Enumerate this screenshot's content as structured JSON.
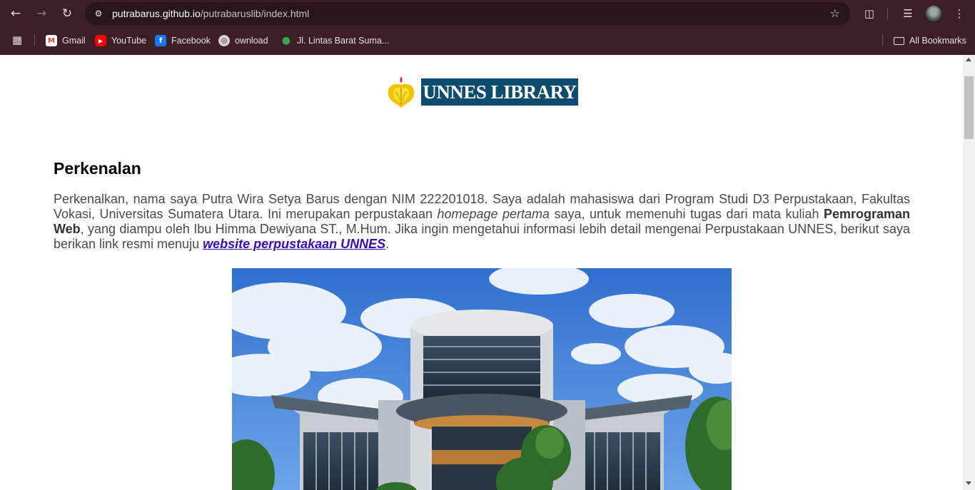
{
  "browser": {
    "url_host": "putrabarus.github.io",
    "url_path": "/putrabaruslib/index.html",
    "bookmarks": [
      {
        "label": "Gmail",
        "icon": "gmail-icon"
      },
      {
        "label": "YouTube",
        "icon": "youtube-icon"
      },
      {
        "label": "Facebook",
        "icon": "facebook-icon"
      },
      {
        "label": "ownload",
        "icon": "globe-icon"
      },
      {
        "label": "Jl. Lintas Barat Suma...",
        "icon": "maps-pin-icon"
      }
    ],
    "all_bookmarks_label": "All Bookmarks"
  },
  "page": {
    "logo_text": "UNNES LIBRARY",
    "heading": "Perkenalan",
    "para_1": "Perkenalkan, nama saya Putra Wira Setya Barus dengan NIM 222201018. Saya adalah mahasiswa dari Program Studi D3 Perpustakaan, Fakultas Vokasi, Universitas Sumatera Utara. Ini merupakan perpustakaan ",
    "para_italic": "homepage pertama",
    "para_2": " saya, untuk memenuhi tugas dari mata kuliah ",
    "para_bold": "Pemrograman Web",
    "para_3": ", yang diampu oleh Ibu Himma Dewiyana ST., M.Hum. Jika ingin mengetahui informasi lebih detail mengenai Perpustakaan UNNES, berikut saya berikan link resmi menuju ",
    "link_text": "website perpustakaan UNNES",
    "para_end": "."
  },
  "colors": {
    "chrome_bg": "#3c1f24",
    "omnibox_bg": "#26161a",
    "logo_banner": "#0e4c6e",
    "link": "#3b0ab8"
  }
}
